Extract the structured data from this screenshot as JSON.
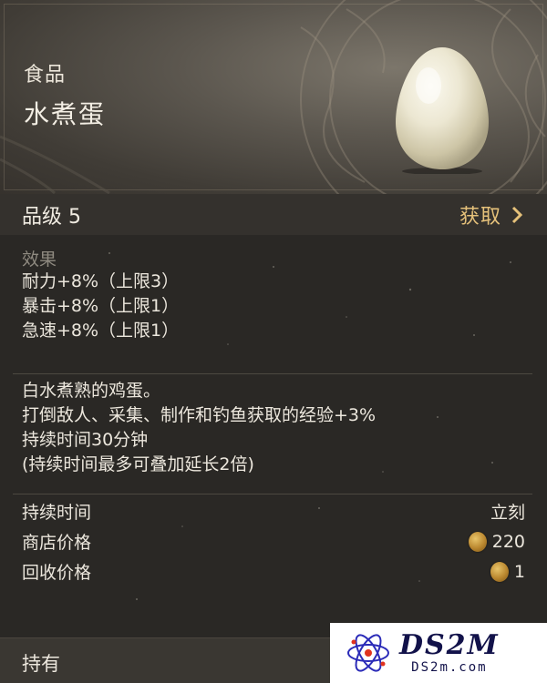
{
  "header": {
    "category": "食品",
    "item_name": "水煮蛋",
    "item_icon": "boiled-egg-icon"
  },
  "grade_bar": {
    "grade": "品级 5",
    "acquire_label": "获取",
    "acquire_icon": "chevron-right-icon"
  },
  "effects": {
    "title": "效果",
    "lines": [
      "耐力+8%（上限3）",
      "暴击+8%（上限1）",
      "急速+8%（上限1）"
    ]
  },
  "description": {
    "lines": [
      "白水煮熟的鸡蛋。",
      "打倒敌人、采集、制作和钓鱼获取的经验+3%",
      "持续时间30分钟",
      "(持续时间最多可叠加延长2倍)"
    ]
  },
  "stats": [
    {
      "label": "持续时间",
      "value": "立刻",
      "coin": false
    },
    {
      "label": "商店价格",
      "value": "220",
      "coin": true
    },
    {
      "label": "回收价格",
      "value": "1",
      "coin": true
    }
  ],
  "held": {
    "label": "持有"
  },
  "watermark": {
    "big": "DS2M",
    "small": "DS2m.com"
  },
  "colors": {
    "accent_gold": "#e5c17a",
    "coin": "#c9952f"
  }
}
